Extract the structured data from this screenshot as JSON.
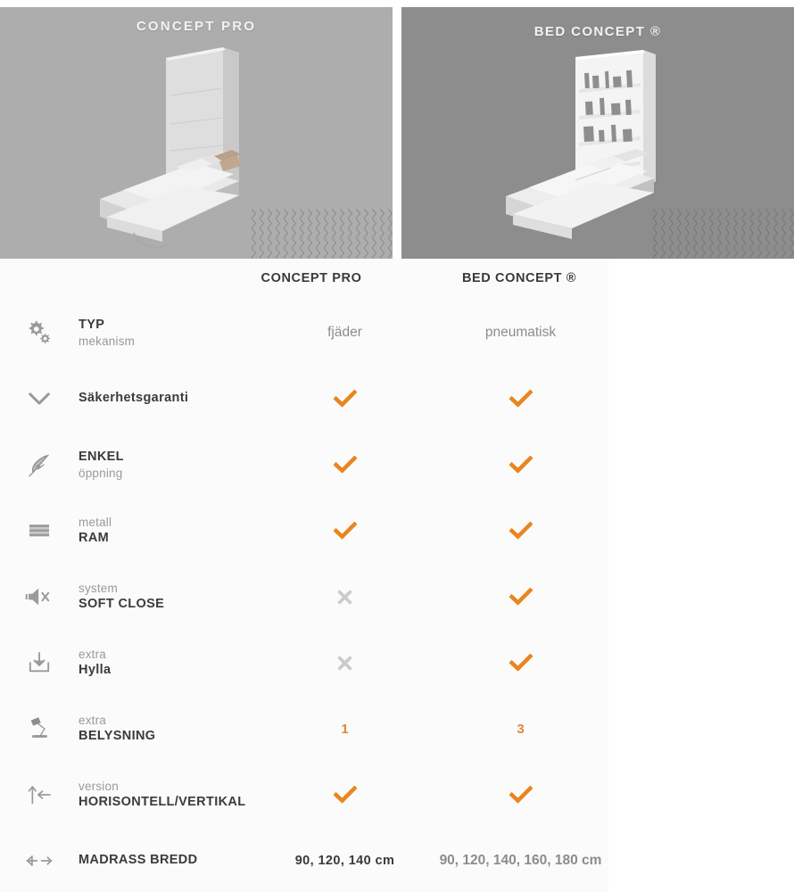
{
  "hero": {
    "left": {
      "title": "CONCEPT PRO",
      "bg": "#adadad",
      "product": "wall-bed-concept-pro"
    },
    "right": {
      "title": "BED CONCEPT ®",
      "bg": "#8d8d8d",
      "product": "wall-bed-bed-concept-with-shelves"
    }
  },
  "colors": {
    "check": "#e8861f",
    "cross": "#cbcbcb",
    "label_strong": "#3b3b3b",
    "label_weak": "#999999",
    "panel_bg": "#fbfbfb"
  },
  "table": {
    "columns": [
      {
        "key": "concept_pro",
        "label": "CONCEPT PRO"
      },
      {
        "key": "bed_concept",
        "label": "BED CONCEPT ®"
      }
    ],
    "rows": [
      {
        "icon": "gears-icon",
        "strong": "TYP",
        "weak": "mekanism",
        "order": "strong-first",
        "concept_pro": {
          "type": "text",
          "value": "fjäder"
        },
        "bed_concept": {
          "type": "text",
          "value": "pneumatisk"
        }
      },
      {
        "icon": "chevron-down-icon",
        "strong": "Säkerhetsgaranti",
        "weak": "",
        "order": "strong-only",
        "concept_pro": {
          "type": "check",
          "value": "✔"
        },
        "bed_concept": {
          "type": "check",
          "value": "✔"
        }
      },
      {
        "icon": "feather-icon",
        "strong": "ENKEL",
        "weak": "öppning",
        "order": "strong-first",
        "concept_pro": {
          "type": "check",
          "value": "✔"
        },
        "bed_concept": {
          "type": "check",
          "value": "✔"
        }
      },
      {
        "icon": "frame-bars-icon",
        "strong": "RAM",
        "weak": "metall",
        "order": "weak-first",
        "concept_pro": {
          "type": "check",
          "value": "✔"
        },
        "bed_concept": {
          "type": "check",
          "value": "✔"
        }
      },
      {
        "icon": "mute-speaker-icon",
        "strong": "SOFT CLOSE",
        "weak": "system",
        "order": "weak-first",
        "concept_pro": {
          "type": "cross",
          "value": "✖"
        },
        "bed_concept": {
          "type": "check",
          "value": "✔"
        }
      },
      {
        "icon": "shelf-download-icon",
        "strong": "Hylla",
        "weak": "extra",
        "order": "weak-first",
        "concept_pro": {
          "type": "cross",
          "value": "✖"
        },
        "bed_concept": {
          "type": "check",
          "value": "✔"
        }
      },
      {
        "icon": "desk-lamp-icon",
        "strong": "BELYSNING",
        "weak": "extra",
        "order": "weak-first",
        "concept_pro": {
          "type": "number",
          "value": "1"
        },
        "bed_concept": {
          "type": "number",
          "value": "3"
        }
      },
      {
        "icon": "up-left-arrows-icon",
        "strong": "HORISONTELL/VERTIKAL",
        "weak": "version",
        "order": "weak-first",
        "concept_pro": {
          "type": "check",
          "value": "✔"
        },
        "bed_concept": {
          "type": "check",
          "value": "✔"
        }
      },
      {
        "icon": "left-right-arrows-icon",
        "strong": "MADRASS BREDD",
        "weak": "",
        "order": "strong-only",
        "concept_pro": {
          "type": "text-dark",
          "value": "90, 120, 140 cm"
        },
        "bed_concept": {
          "type": "text",
          "value": "90, 120, 140, 160, 180 cm"
        }
      }
    ]
  }
}
